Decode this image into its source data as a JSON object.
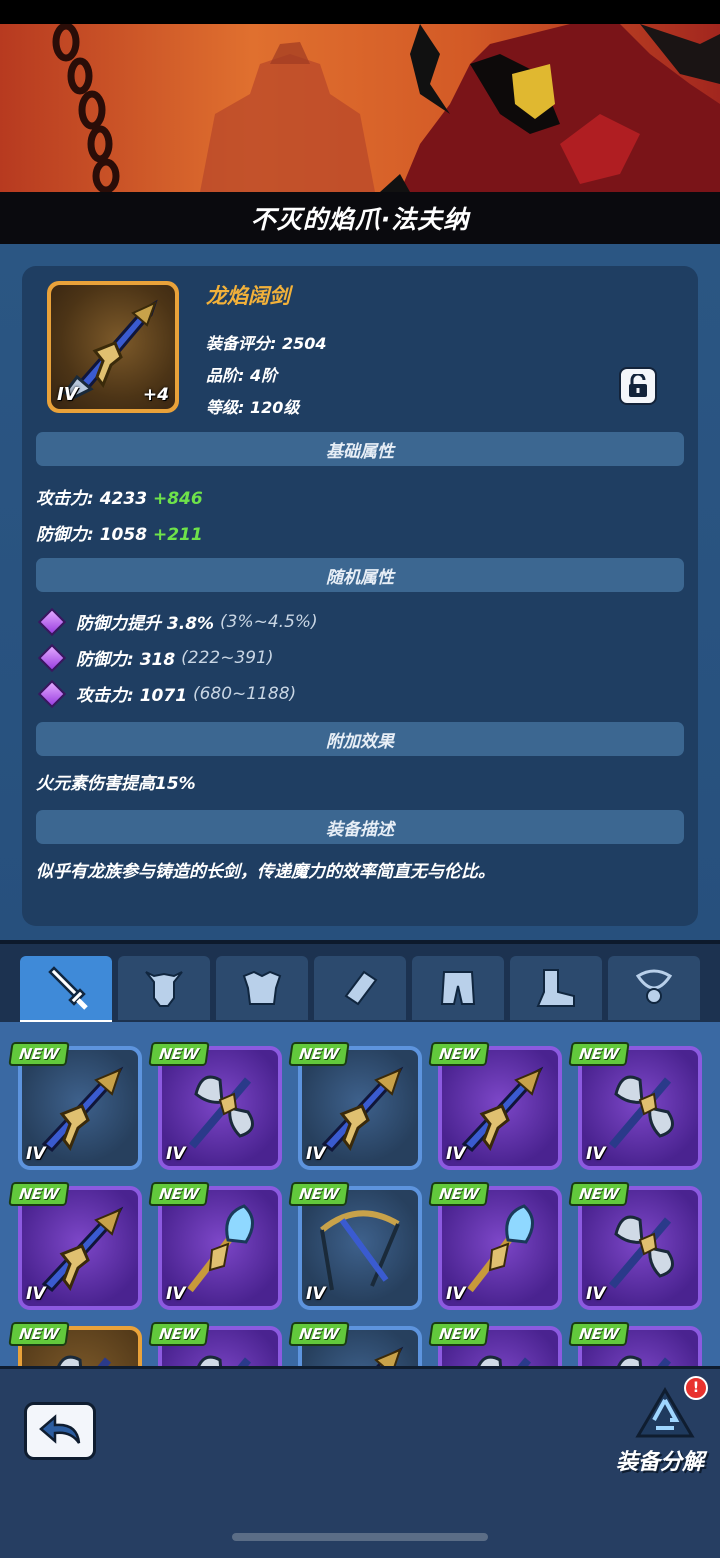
{
  "hero": {
    "name": "不灭的焰爪·法夫纳"
  },
  "item": {
    "name": "龙焰阔剑",
    "score_label": "装备评分: 2504",
    "grade_label": "品阶: 4阶",
    "level_label": "等级: 120级",
    "tier": "IV",
    "enhance": "+4"
  },
  "sections": {
    "basic": "基础属性",
    "random": "随机属性",
    "extra": "附加效果",
    "desc": "装备描述"
  },
  "basic_stats": [
    {
      "label": "攻击力: 4233",
      "bonus": "+846"
    },
    {
      "label": "防御力: 1058",
      "bonus": "+211"
    }
  ],
  "random_stats": [
    {
      "label": "防御力提升 3.8%",
      "range": "(3%~4.5%)"
    },
    {
      "label": "防御力: 318",
      "range": "(222~391)"
    },
    {
      "label": "攻击力: 1071",
      "range": "(680~1188)"
    }
  ],
  "extra_effect": "火元素伤害提高15%",
  "description": "似乎有龙族参与铸造的长剑，传递魔力的效率简直无与伦比。",
  "tabs": [
    {
      "icon": "sword-icon",
      "active": true
    },
    {
      "icon": "helmet-icon",
      "active": false
    },
    {
      "icon": "armor-icon",
      "active": false
    },
    {
      "icon": "gauntlet-icon",
      "active": false
    },
    {
      "icon": "pants-icon",
      "active": false
    },
    {
      "icon": "boots-icon",
      "active": false
    },
    {
      "icon": "amulet-icon",
      "active": false
    }
  ],
  "grid": {
    "new_label": "NEW",
    "tier_label": "IV",
    "items": [
      {
        "rarity": "blue",
        "icon": "sword-icon"
      },
      {
        "rarity": "purple",
        "icon": "axe-icon"
      },
      {
        "rarity": "blue",
        "icon": "sword-icon"
      },
      {
        "rarity": "purple",
        "icon": "sword-icon"
      },
      {
        "rarity": "purple",
        "icon": "axe-icon"
      },
      {
        "rarity": "purple",
        "icon": "sword-icon"
      },
      {
        "rarity": "purple",
        "icon": "staff-icon"
      },
      {
        "rarity": "blue",
        "icon": "crossbow-icon"
      },
      {
        "rarity": "purple",
        "icon": "staff-icon"
      },
      {
        "rarity": "purple",
        "icon": "axe-icon"
      },
      {
        "rarity": "orange",
        "icon": "axe-icon"
      },
      {
        "rarity": "purple",
        "icon": "axe-icon"
      },
      {
        "rarity": "blue",
        "icon": "sword-icon"
      },
      {
        "rarity": "purple",
        "icon": "axe-icon"
      },
      {
        "rarity": "purple",
        "icon": "axe-icon"
      }
    ]
  },
  "bottom": {
    "decompose_label": "装备分解",
    "alert": "!"
  }
}
